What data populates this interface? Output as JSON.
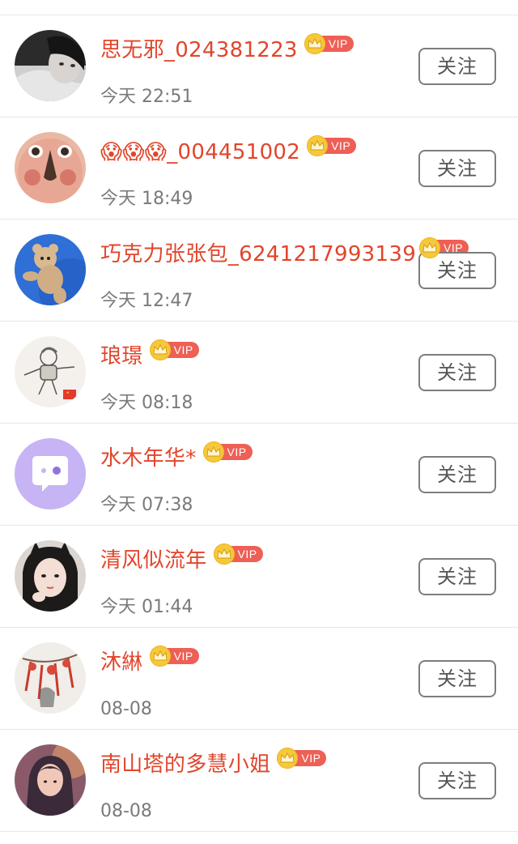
{
  "followers": [
    {
      "name": "思无邪_024381223",
      "vip": "VIP",
      "time": "今天 22:51",
      "follow_label": "关注",
      "avatar_icon": "avatar-photo-girl-blanket"
    },
    {
      "name": "😱😱😱_004451002",
      "vip": "VIP",
      "time": "今天 18:49",
      "follow_label": "关注",
      "avatar_icon": "avatar-photo-child-face"
    },
    {
      "name": "巧克力张张包_6241217993139",
      "vip": "VIP",
      "time": "今天 12:47",
      "follow_label": "关注",
      "avatar_icon": "avatar-teddy-bear-sky"
    },
    {
      "name": "琅璟",
      "vip": "VIP",
      "time": "今天 08:18",
      "follow_label": "关注",
      "avatar_icon": "avatar-cartoon-kid"
    },
    {
      "name": "水木年华*",
      "vip": "VIP",
      "time": "今天 07:38",
      "follow_label": "关注",
      "avatar_icon": "avatar-default-chat-bubble"
    },
    {
      "name": "清风似流年",
      "vip": "VIP",
      "time": "今天 01:44",
      "follow_label": "关注",
      "avatar_icon": "avatar-photo-girl-cat-ears"
    },
    {
      "name": "沐綝",
      "vip": "VIP",
      "time": "08-08",
      "follow_label": "关注",
      "avatar_icon": "avatar-ink-painting-red-tree"
    },
    {
      "name": "南山塔的多慧小姐",
      "vip": "VIP",
      "time": "08-08",
      "follow_label": "关注",
      "avatar_icon": "avatar-illustration-girl"
    }
  ],
  "colors": {
    "name": "#e2452b",
    "time": "#7a7a7a",
    "vip_badge": "#ee5f55",
    "vip_crown": "#f4c93b",
    "button_border": "#7d7d7d",
    "divider": "#e7e7e7"
  }
}
